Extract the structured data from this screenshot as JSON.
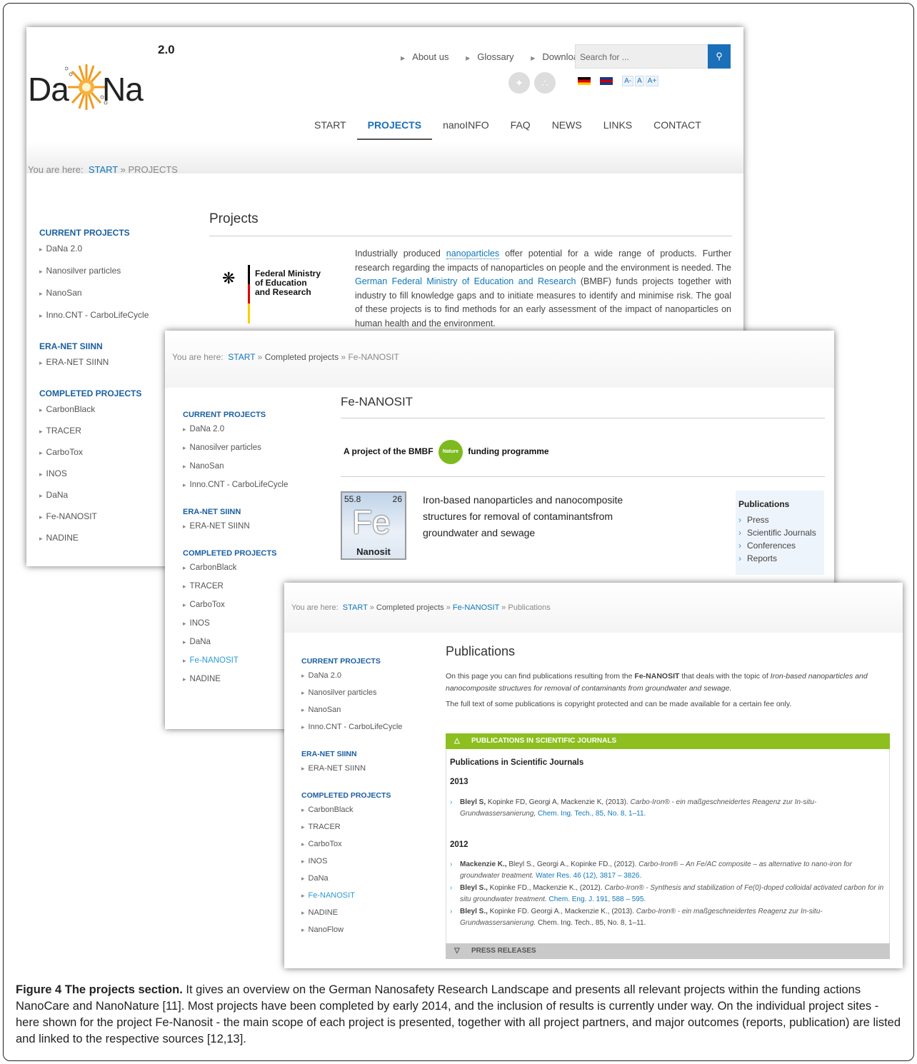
{
  "shot1": {
    "logo": {
      "left": "Da",
      "right": "Na",
      "version": "2.0"
    },
    "top_links": [
      "About us",
      "Glossary",
      "Downloads"
    ],
    "search": {
      "placeholder": "Search for ..."
    },
    "font_size_buttons": [
      "A-",
      "A",
      "A+"
    ],
    "main_nav": [
      "START",
      "PROJECTS",
      "nanoINFO",
      "FAQ",
      "NEWS",
      "LINKS",
      "CONTACT"
    ],
    "active_nav": "PROJECTS",
    "breadcrumb": {
      "prefix": "You are here:",
      "start": "START",
      "sep": "»",
      "current": "PROJECTS"
    },
    "sidebar": {
      "current_heading": "CURRENT PROJECTS",
      "current": [
        "DaNa 2.0",
        "Nanosilver particles",
        "NanoSan",
        "Inno.CNT - CarboLifeCycle"
      ],
      "eranet_heading": "ERA-NET SIINN",
      "eranet": [
        "ERA-NET SIINN"
      ],
      "completed_heading": "COMPLETED PROJECTS",
      "completed": [
        "CarbonBlack",
        "TRACER",
        "CarboTox",
        "INOS",
        "DaNa",
        "Fe-NANOSIT",
        "NADINE"
      ]
    },
    "page_title": "Projects",
    "bmbf_text": "Federal Ministry\nof Education\nand Research",
    "intro_before_link1": "Industrially produced ",
    "intro_link1": "nanoparticles",
    "intro_after_link1": " offer potential for a wide range of products. Further research regarding the impacts of nanoparticles on people and the environment is needed. The ",
    "intro_link2": "German Federal Ministry of Education and Research",
    "intro_after_link2": " (BMBF) funds projects together with industry to fill knowledge gaps and to initiate measures to identify and minimise risk. The goal of these projects is to find methods for an early assessment of the impact of nanoparticles on human health and the environment."
  },
  "shot2": {
    "breadcrumb": {
      "prefix": "You are here:",
      "start": "START",
      "sep": "»",
      "mid": "Completed projects",
      "current": "Fe-NANOSIT"
    },
    "sidebar": {
      "current_heading": "CURRENT PROJECTS",
      "current": [
        "DaNa 2.0",
        "Nanosilver particles",
        "NanoSan",
        "Inno.CNT - CarboLifeCycle"
      ],
      "eranet_heading": "ERA-NET SIINN",
      "eranet": [
        "ERA-NET SIINN"
      ],
      "completed_heading": "COMPLETED PROJECTS",
      "completed": [
        "CarbonBlack",
        "TRACER",
        "CarboTox",
        "INOS",
        "DaNa",
        "Fe-NANOSIT",
        "NADINE"
      ]
    },
    "page_title": "Fe-NANOSIT",
    "funding_before": "A project of the BMBF",
    "funding_badge": "Nature",
    "funding_after": "funding programme",
    "fe_logo": {
      "mass": "55.8",
      "number": "26",
      "symbol": "Fe",
      "name": "Nanosit"
    },
    "project_description": "Iron-based nanoparticles and nanocomposite structures for removal of contaminantsfrom groundwater and sewage",
    "publications_box": {
      "title": "Publications",
      "items": [
        "Press",
        "Scientific Journals",
        "Conferences",
        "Reports"
      ]
    }
  },
  "shot3": {
    "breadcrumb": {
      "prefix": "You are here:",
      "start": "START",
      "sep": "»",
      "mid": "Completed projects",
      "project": "Fe-NANOSIT",
      "current": "Publications"
    },
    "sidebar": {
      "current_heading": "CURRENT PROJECTS",
      "current": [
        "DaNa 2.0",
        "Nanosilver particles",
        "NanoSan",
        "Inno.CNT - CarboLifeCycle"
      ],
      "eranet_heading": "ERA-NET SIINN",
      "eranet": [
        "ERA-NET SIINN"
      ],
      "completed_heading": "COMPLETED PROJECTS",
      "completed": [
        "CarbonBlack",
        "TRACER",
        "CarboTox",
        "INOS",
        "DaNa",
        "Fe-NANOSIT",
        "NADINE",
        "NanoFlow"
      ]
    },
    "page_title": "Publications",
    "intro1_before": "On this page you can find publications resulting from the ",
    "intro1_bold": "Fe-NANOSIT",
    "intro1_mid": " that deals with the topic of ",
    "intro1_italic": "Iron-based nanoparticles and nanocomposite structures for removal of contaminants from groundwater and sewage.",
    "intro2": "The full text of some publications is copyright protected and can be made available for a certain fee only.",
    "journals_bar": "PUBLICATIONS IN SCIENTIFIC JOURNALS",
    "journals_heading": "Publications in Scientific Journals",
    "year1": "2013",
    "year2": "2012",
    "refs": [
      {
        "bold": "Bleyl S,",
        "authors": " Kopinke FD, Georgi A, Mackenzie K, (2013). ",
        "title": "Carbo-Iron® - ein maßgeschneidertes Reagenz zur In-situ-Grundwassersanierung,",
        "source": " Chem. Ing. Tech., 85, No. 8, 1–11."
      },
      {
        "bold": "Mackenzie K.,",
        "authors": " Bleyl S., Georgi A., Kopinke FD., (2012). ",
        "title": "Carbo-Iron® – An Fe/AC composite – as alternative to nano-iron for groundwater treatment.",
        "source": " Water Res. 46 (12), 3817 – 3826."
      },
      {
        "bold": "Bleyl S.,",
        "authors": " Kopinke FD., Mackenzie K., (2012). ",
        "title": "Carbo-Iron® - Synthesis and stabilization of Fe(0)-doped colloidal activated carbon for in situ groundwater treatment.",
        "source": " Chem. Eng. J. 191, 588 – 595."
      },
      {
        "bold": "Bleyl S.,",
        "authors": " Kopinke FD. Georgi A., Mackenzie K., (2013). ",
        "title": "Carbo-Iron® - ein maßgeschneidertes Reagenz zur In-situ-Grundwassersanierung.",
        "source": " Chem. Ing. Tech., 85, No. 8, 1–11."
      }
    ],
    "press_bar": "PRESS RELEASES"
  },
  "caption": {
    "label": "Figure 4 The projects section.",
    "text": " It gives an overview on the German Nanosafety Research Landscape and presents all relevant projects within the funding actions NanoCare and NanoNature [11]. Most projects have been completed by early 2014, and the inclusion of results is currently under way. On the individual project sites - here shown for the project Fe-Nanosit - the main scope of each project is presented, together with all project partners, and major outcomes (reports, publication) are listed and linked to the respective sources [12,13]."
  },
  "colors": {
    "link_blue": "#0f77b9",
    "nav_blue": "#1a6fb8",
    "green_bar": "#8cbf1f",
    "sun_orange": "#f39a1e"
  }
}
